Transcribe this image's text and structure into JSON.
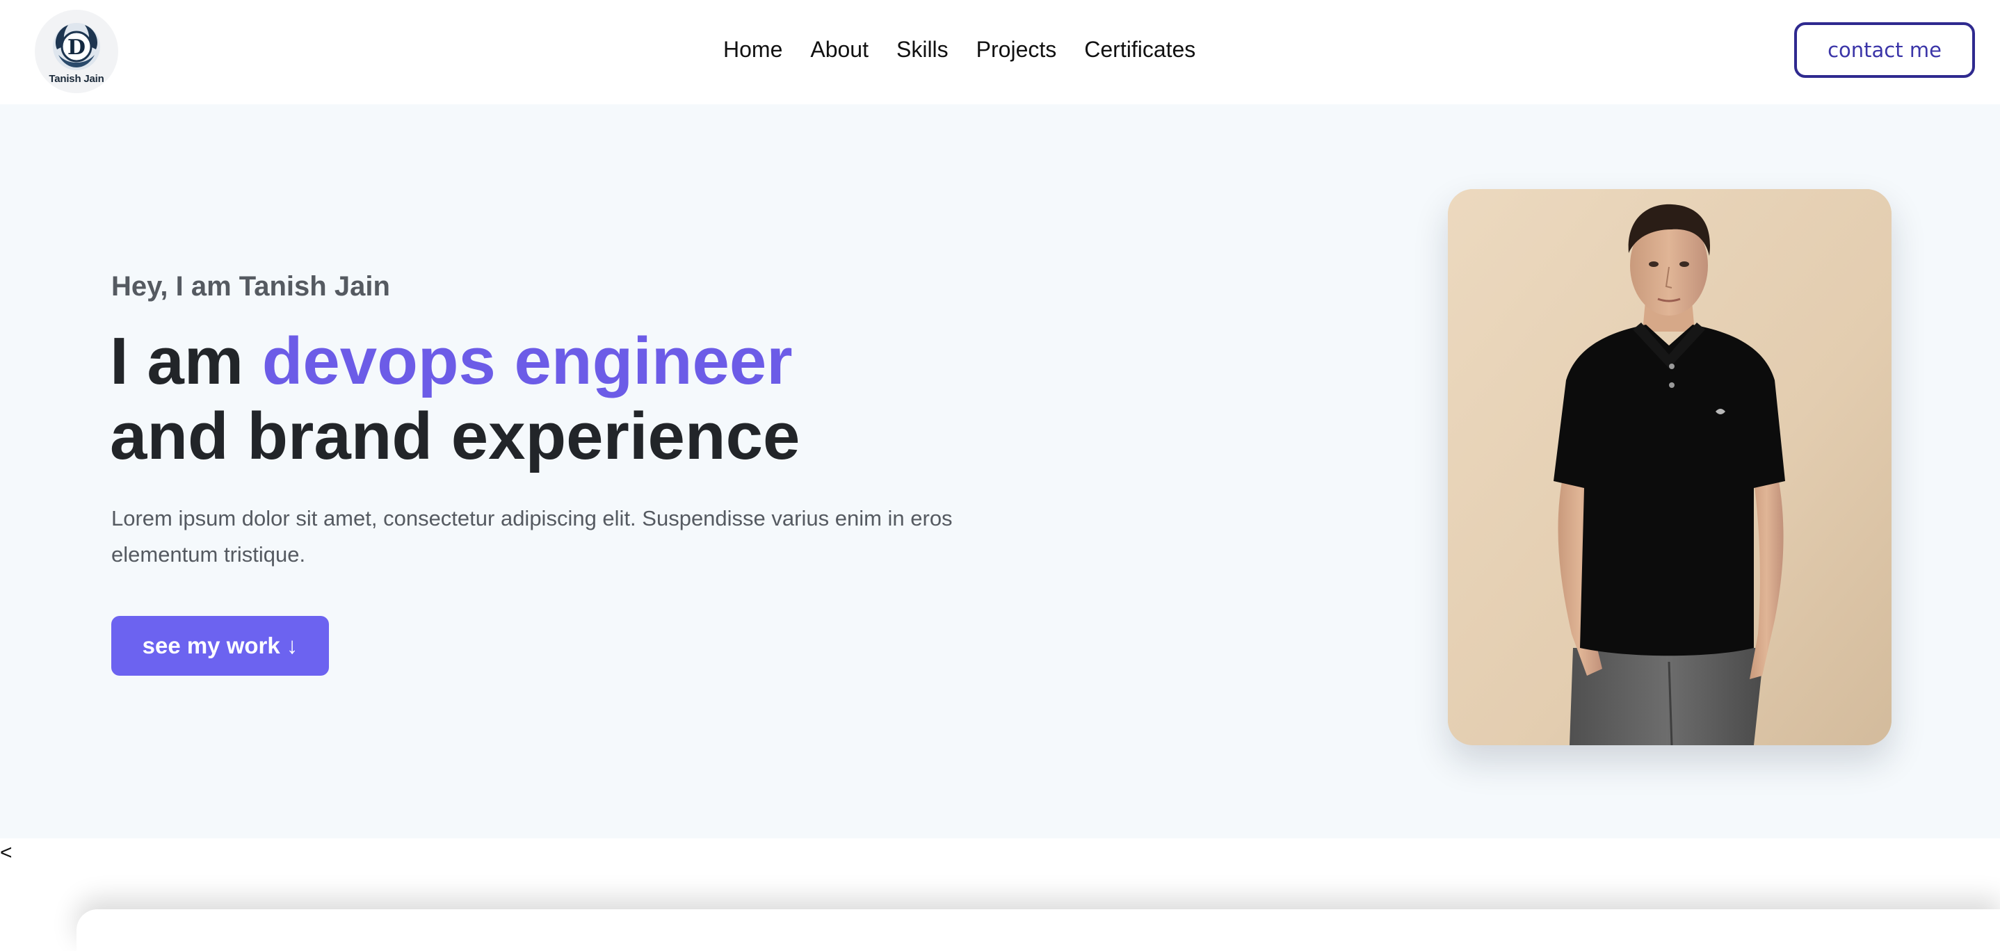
{
  "brand": {
    "logo_letter": "D",
    "logo_name": "Tanish Jain"
  },
  "nav": {
    "items": [
      {
        "label": "Home"
      },
      {
        "label": "About"
      },
      {
        "label": "Skills"
      },
      {
        "label": "Projects"
      },
      {
        "label": "Certificates"
      }
    ],
    "contact_label": "contact me"
  },
  "hero": {
    "greeting": "Hey, I am Tanish Jain",
    "headline_prefix": "I am ",
    "headline_accent": "devops engineer",
    "headline_line2": "and brand experience",
    "intro": "Lorem ipsum dolor sit amet, consectetur adipiscing elit. Suspendisse varius enim in eros elementum tristique.",
    "cta_label": "see my work ↓"
  },
  "carousel": {
    "prev_label": "<"
  },
  "colors": {
    "accent": "#6c5ce7",
    "button": "#6c63f0",
    "contact_border": "#2f2a8f",
    "hero_bg": "#f5f9fc",
    "heading": "#222529",
    "body_text": "#555a61"
  }
}
